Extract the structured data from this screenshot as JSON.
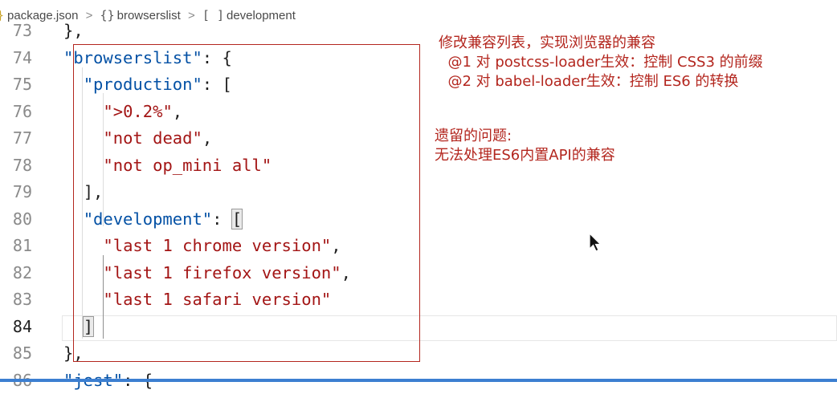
{
  "breadcrumb": {
    "items": [
      {
        "icon": "}",
        "label": "package.json"
      },
      {
        "icon": "{}",
        "label": "browserslist"
      },
      {
        "icon": "[ ]",
        "label": "development"
      }
    ],
    "separator": ">"
  },
  "editor": {
    "active_line": 84,
    "lines": [
      {
        "n": "73",
        "segments": [
          [
            "punc",
            "},"
          ]
        ]
      },
      {
        "n": "74",
        "segments": [
          [
            "key",
            "\"browserslist\""
          ],
          [
            "punc",
            ": {"
          ]
        ]
      },
      {
        "n": "75",
        "segments": [
          [
            "key",
            "\"production\""
          ],
          [
            "punc",
            ": ["
          ]
        ]
      },
      {
        "n": "76",
        "segments": [
          [
            "str",
            "\">0.2%\""
          ],
          [
            "punc",
            ","
          ]
        ]
      },
      {
        "n": "77",
        "segments": [
          [
            "str",
            "\"not dead\""
          ],
          [
            "punc",
            ","
          ]
        ]
      },
      {
        "n": "78",
        "segments": [
          [
            "str",
            "\"not op_mini all\""
          ]
        ]
      },
      {
        "n": "79",
        "segments": [
          [
            "punc",
            "],"
          ]
        ]
      },
      {
        "n": "80",
        "segments": [
          [
            "key",
            "\"development\""
          ],
          [
            "punc",
            ": "
          ],
          [
            "brk",
            "["
          ]
        ]
      },
      {
        "n": "81",
        "segments": [
          [
            "str",
            "\"last 1 chrome version\""
          ],
          [
            "punc",
            ","
          ]
        ]
      },
      {
        "n": "82",
        "segments": [
          [
            "str",
            "\"last 1 firefox version\""
          ],
          [
            "punc",
            ","
          ]
        ]
      },
      {
        "n": "83",
        "segments": [
          [
            "str",
            "\"last 1 safari version\""
          ]
        ]
      },
      {
        "n": "84",
        "segments": [
          [
            "brk",
            "]"
          ]
        ]
      },
      {
        "n": "85",
        "segments": [
          [
            "punc",
            "},"
          ]
        ]
      },
      {
        "n": "86",
        "segments": [
          [
            "key",
            "\"jest\""
          ],
          [
            "punc",
            ": {"
          ]
        ]
      }
    ]
  },
  "annotations": {
    "note1": "修改兼容列表，实现浏览器的兼容\n  @1 对 postcss-loader生效：控制 CSS3 的前缀\n  @2 对 babel-loader生效：控制 ES6 的转换",
    "note2": "遗留的问题:\n无法处理ES6内置API的兼容"
  },
  "colors": {
    "key": "#0451a5",
    "string": "#a31515",
    "annotation": "#b3261e",
    "status_bar": "#3c7fd1"
  }
}
